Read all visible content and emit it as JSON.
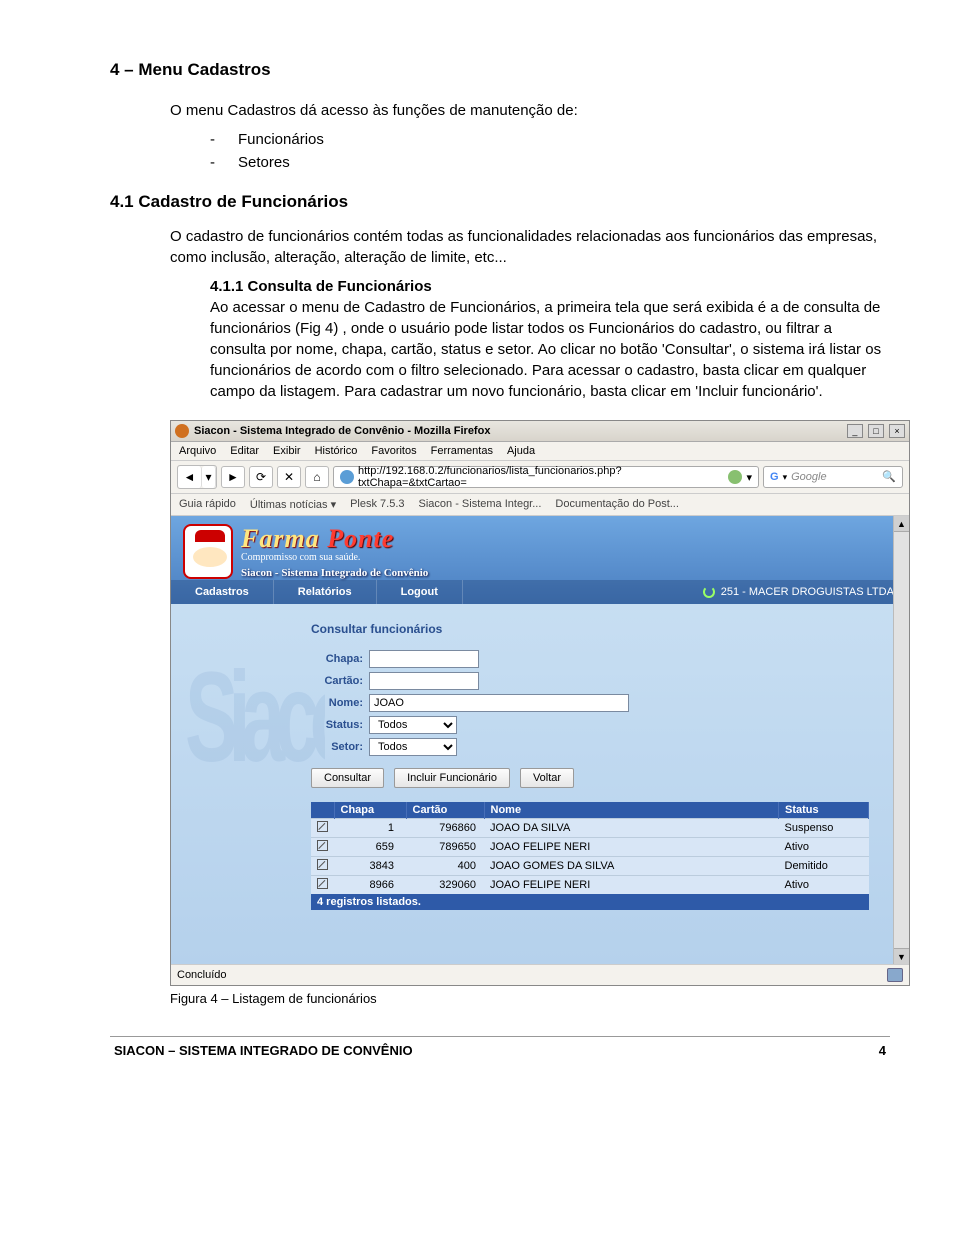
{
  "doc": {
    "h1": "4 – Menu Cadastros",
    "intro": "O menu Cadastros dá acesso às funções de manutenção de:",
    "bullets": [
      "Funcionários",
      "Setores"
    ],
    "h2": "4.1 Cadastro de Funcionários",
    "p1": "O cadastro de funcionários contém todas as funcionalidades relacionadas aos funcionários das empresas, como inclusão, alteração, alteração de limite, etc...",
    "sub_num": "4.1.1 Consulta de Funcionários",
    "p2": "Ao acessar o menu de Cadastro de Funcionários, a primeira tela que será exibida é a de consulta de funcionários (Fig 4) , onde o usuário pode listar todos os Funcionários do cadastro, ou filtrar a consulta por nome, chapa, cartão, status e setor. Ao clicar no botão 'Consultar', o sistema irá listar os funcionários de acordo com o filtro selecionado. Para acessar o cadastro, basta clicar em qualquer campo da listagem. Para cadastrar um novo funcionário, basta clicar em 'Incluir funcionário'.",
    "caption": "Figura 4 – Listagem de funcionários"
  },
  "browser": {
    "title": "Siacon - Sistema Integrado de Convênio - Mozilla Firefox",
    "menu": [
      "Arquivo",
      "Editar",
      "Exibir",
      "Histórico",
      "Favoritos",
      "Ferramentas",
      "Ajuda"
    ],
    "url": "http://192.168.0.2/funcionarios/lista_funcionarios.php?txtChapa=&txtCartao=",
    "search_engine": "Google",
    "bookmarks": [
      "Guia rápido",
      "Últimas notícias ▾",
      "Plesk 7.5.3",
      "Siacon - Sistema Integr...",
      "Documentação do Post..."
    ],
    "status": "Concluído"
  },
  "site": {
    "brand_a": "Farma",
    "brand_b": "Ponte",
    "slogan": "Compromisso com sua saúde.",
    "system": "Siacon - Sistema Integrado de Convênio",
    "nav": [
      "Cadastros",
      "Relatórios",
      "Logout"
    ],
    "right_header": "251 - MACER DROGUISTAS LTDA.",
    "panel_title": "Consultar funcionários",
    "labels": {
      "chapa": "Chapa:",
      "cartao": "Cartão:",
      "nome": "Nome:",
      "status": "Status:",
      "setor": "Setor:"
    },
    "values": {
      "chapa": "",
      "cartao": "",
      "nome": "JOAO",
      "status": "Todos",
      "setor": "Todos"
    },
    "buttons": {
      "consultar": "Consultar",
      "incluir": "Incluir Funcionário",
      "voltar": "Voltar"
    },
    "grid": {
      "headers": [
        "",
        "Chapa",
        "Cartão",
        "Nome",
        "Status"
      ],
      "rows": [
        {
          "chapa": "1",
          "cartao": "796860",
          "nome": "JOAO DA SILVA",
          "status": "Suspenso"
        },
        {
          "chapa": "659",
          "cartao": "789650",
          "nome": "JOAO FELIPE NERI",
          "status": "Ativo"
        },
        {
          "chapa": "3843",
          "cartao": "400",
          "nome": "JOAO GOMES DA SILVA",
          "status": "Demitido"
        },
        {
          "chapa": "8966",
          "cartao": "329060",
          "nome": "JOAO FELIPE NERI",
          "status": "Ativo"
        }
      ],
      "footer": "4   registros listados."
    }
  },
  "footer": {
    "left": "SIACON – SISTEMA INTEGRADO DE CONVÊNIO",
    "right": "4"
  }
}
